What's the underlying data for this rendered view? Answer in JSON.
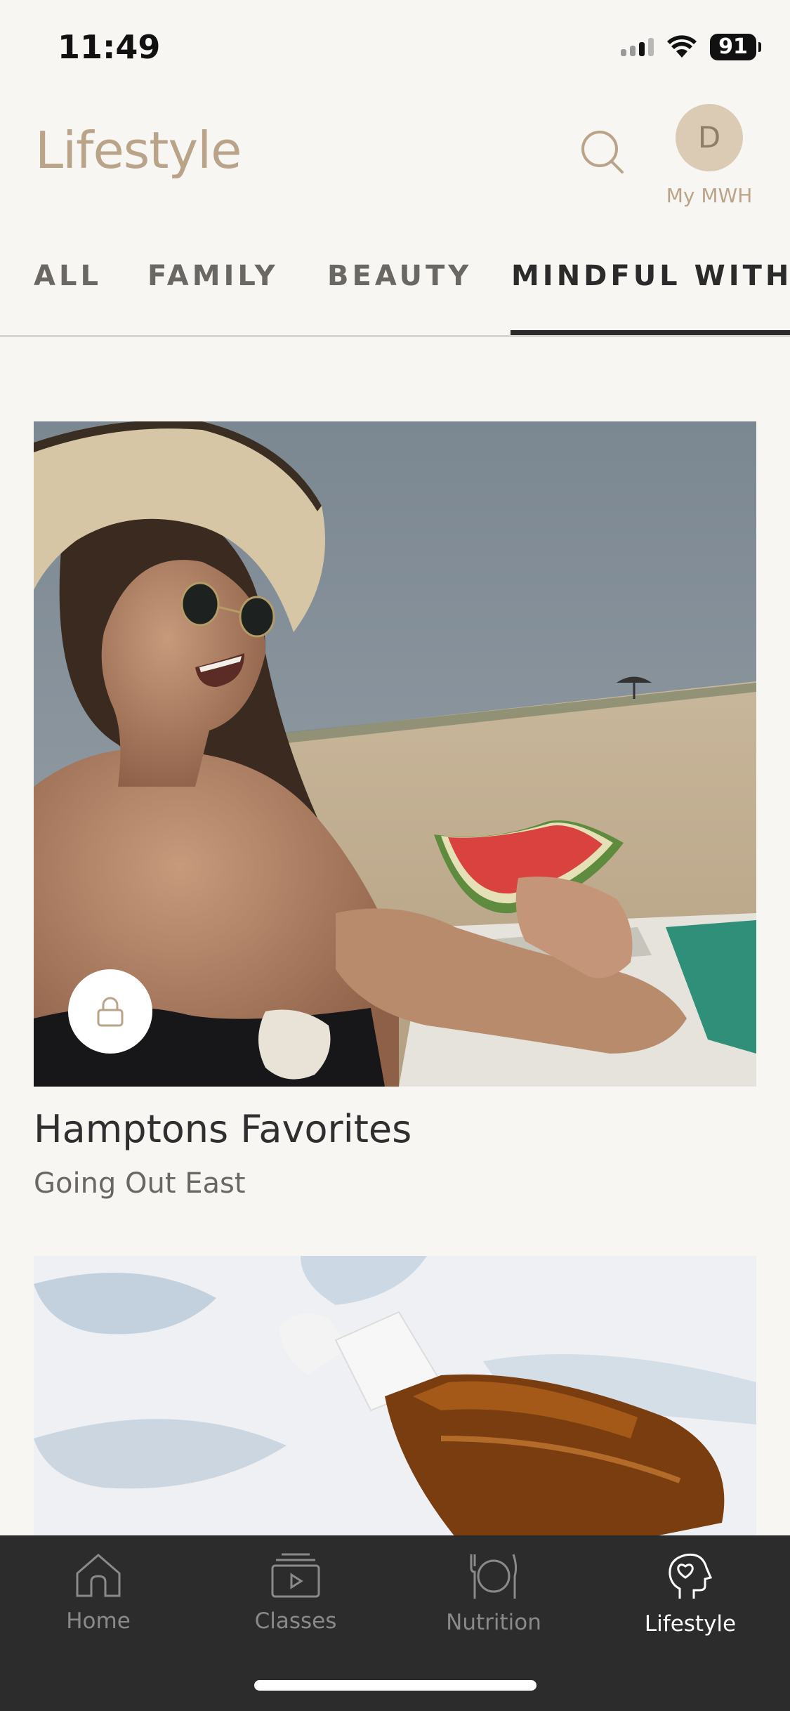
{
  "status_bar": {
    "time": "11:49",
    "battery": "91"
  },
  "header": {
    "title": "Lifestyle",
    "avatar_initial": "D",
    "avatar_label": "My MWH"
  },
  "tabs": [
    {
      "label": "ALL",
      "active": false
    },
    {
      "label": "FAMILY",
      "active": false
    },
    {
      "label": "BEAUTY",
      "active": false
    },
    {
      "label": "MINDFUL WITH",
      "active": true
    }
  ],
  "cards": [
    {
      "title": "Hamptons Favorites",
      "subtitle": "Going Out East",
      "locked": true,
      "image": "beach-watermelon-photo"
    },
    {
      "image": "amber-dropper-bottle-photo"
    }
  ],
  "bottom_nav": [
    {
      "label": "Home",
      "icon": "home-icon",
      "active": false
    },
    {
      "label": "Classes",
      "icon": "classes-icon",
      "active": false
    },
    {
      "label": "Nutrition",
      "icon": "nutrition-icon",
      "active": false
    },
    {
      "label": "Lifestyle",
      "icon": "lifestyle-icon",
      "active": true
    }
  ]
}
